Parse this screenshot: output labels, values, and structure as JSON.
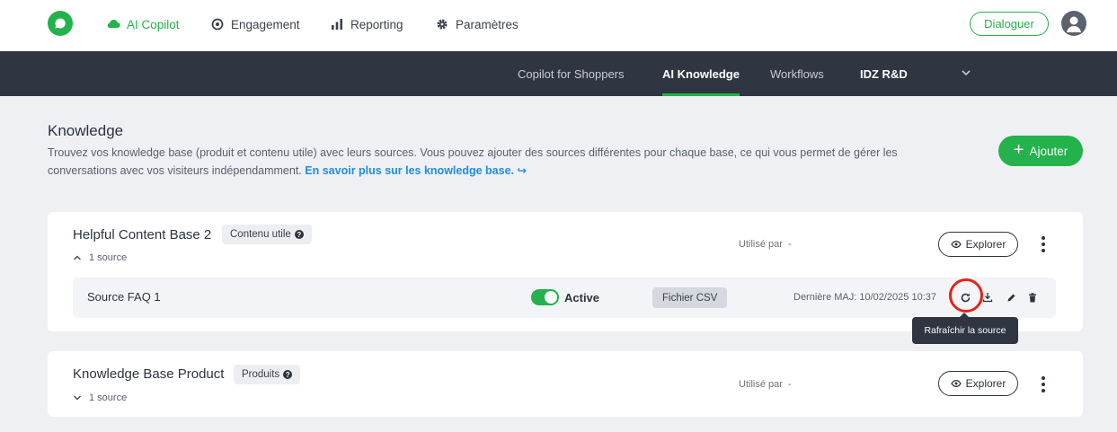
{
  "topnav": {
    "items": [
      {
        "label": "AI Copilot",
        "icon": "cloud-icon",
        "active": true
      },
      {
        "label": "Engagement",
        "icon": "target-icon",
        "active": false
      },
      {
        "label": "Reporting",
        "icon": "bar-chart-icon",
        "active": false
      },
      {
        "label": "Paramètres",
        "icon": "gear-icon",
        "active": false
      }
    ],
    "dialoguer_label": "Dialoguer"
  },
  "subnav": {
    "tabs": [
      {
        "label": "Copilot for Shoppers",
        "active": false
      },
      {
        "label": "AI Knowledge",
        "active": true
      },
      {
        "label": "Workflows",
        "active": false
      },
      {
        "label": "IDZ R&D",
        "active": false
      }
    ]
  },
  "page": {
    "title": "Knowledge",
    "description": "Trouvez vos knowledge base (produit et contenu utile) avec leurs sources. Vous pouvez ajouter des sources différentes pour chaque base, ce qui vous permet de gérer les conversations avec vos visiteurs indépendamment.",
    "learn_more": "En savoir plus sur les knowledge base.",
    "add_label": "Ajouter"
  },
  "bases": [
    {
      "name": "Helpful Content Base 2",
      "tag": "Contenu utile",
      "sources_count": "1 source",
      "used_by": "Utilisé par",
      "used_by_value": "-",
      "explore_label": "Explorer",
      "expanded": true,
      "sources": [
        {
          "name": "Source FAQ 1",
          "status": "Active",
          "type": "Fichier CSV",
          "last_update": "Dernière MAJ: 10/02/2025 10:37"
        }
      ]
    },
    {
      "name": "Knowledge Base Product",
      "tag": "Produits",
      "sources_count": "1 source",
      "used_by": "Utilisé par",
      "used_by_value": "-",
      "explore_label": "Explorer",
      "expanded": false
    }
  ],
  "tooltip": "Rafraîchir la source",
  "colors": {
    "accent": "#23b24b",
    "dark": "#2f3541",
    "link": "#1f8de0",
    "highlight": "#e0251b"
  }
}
